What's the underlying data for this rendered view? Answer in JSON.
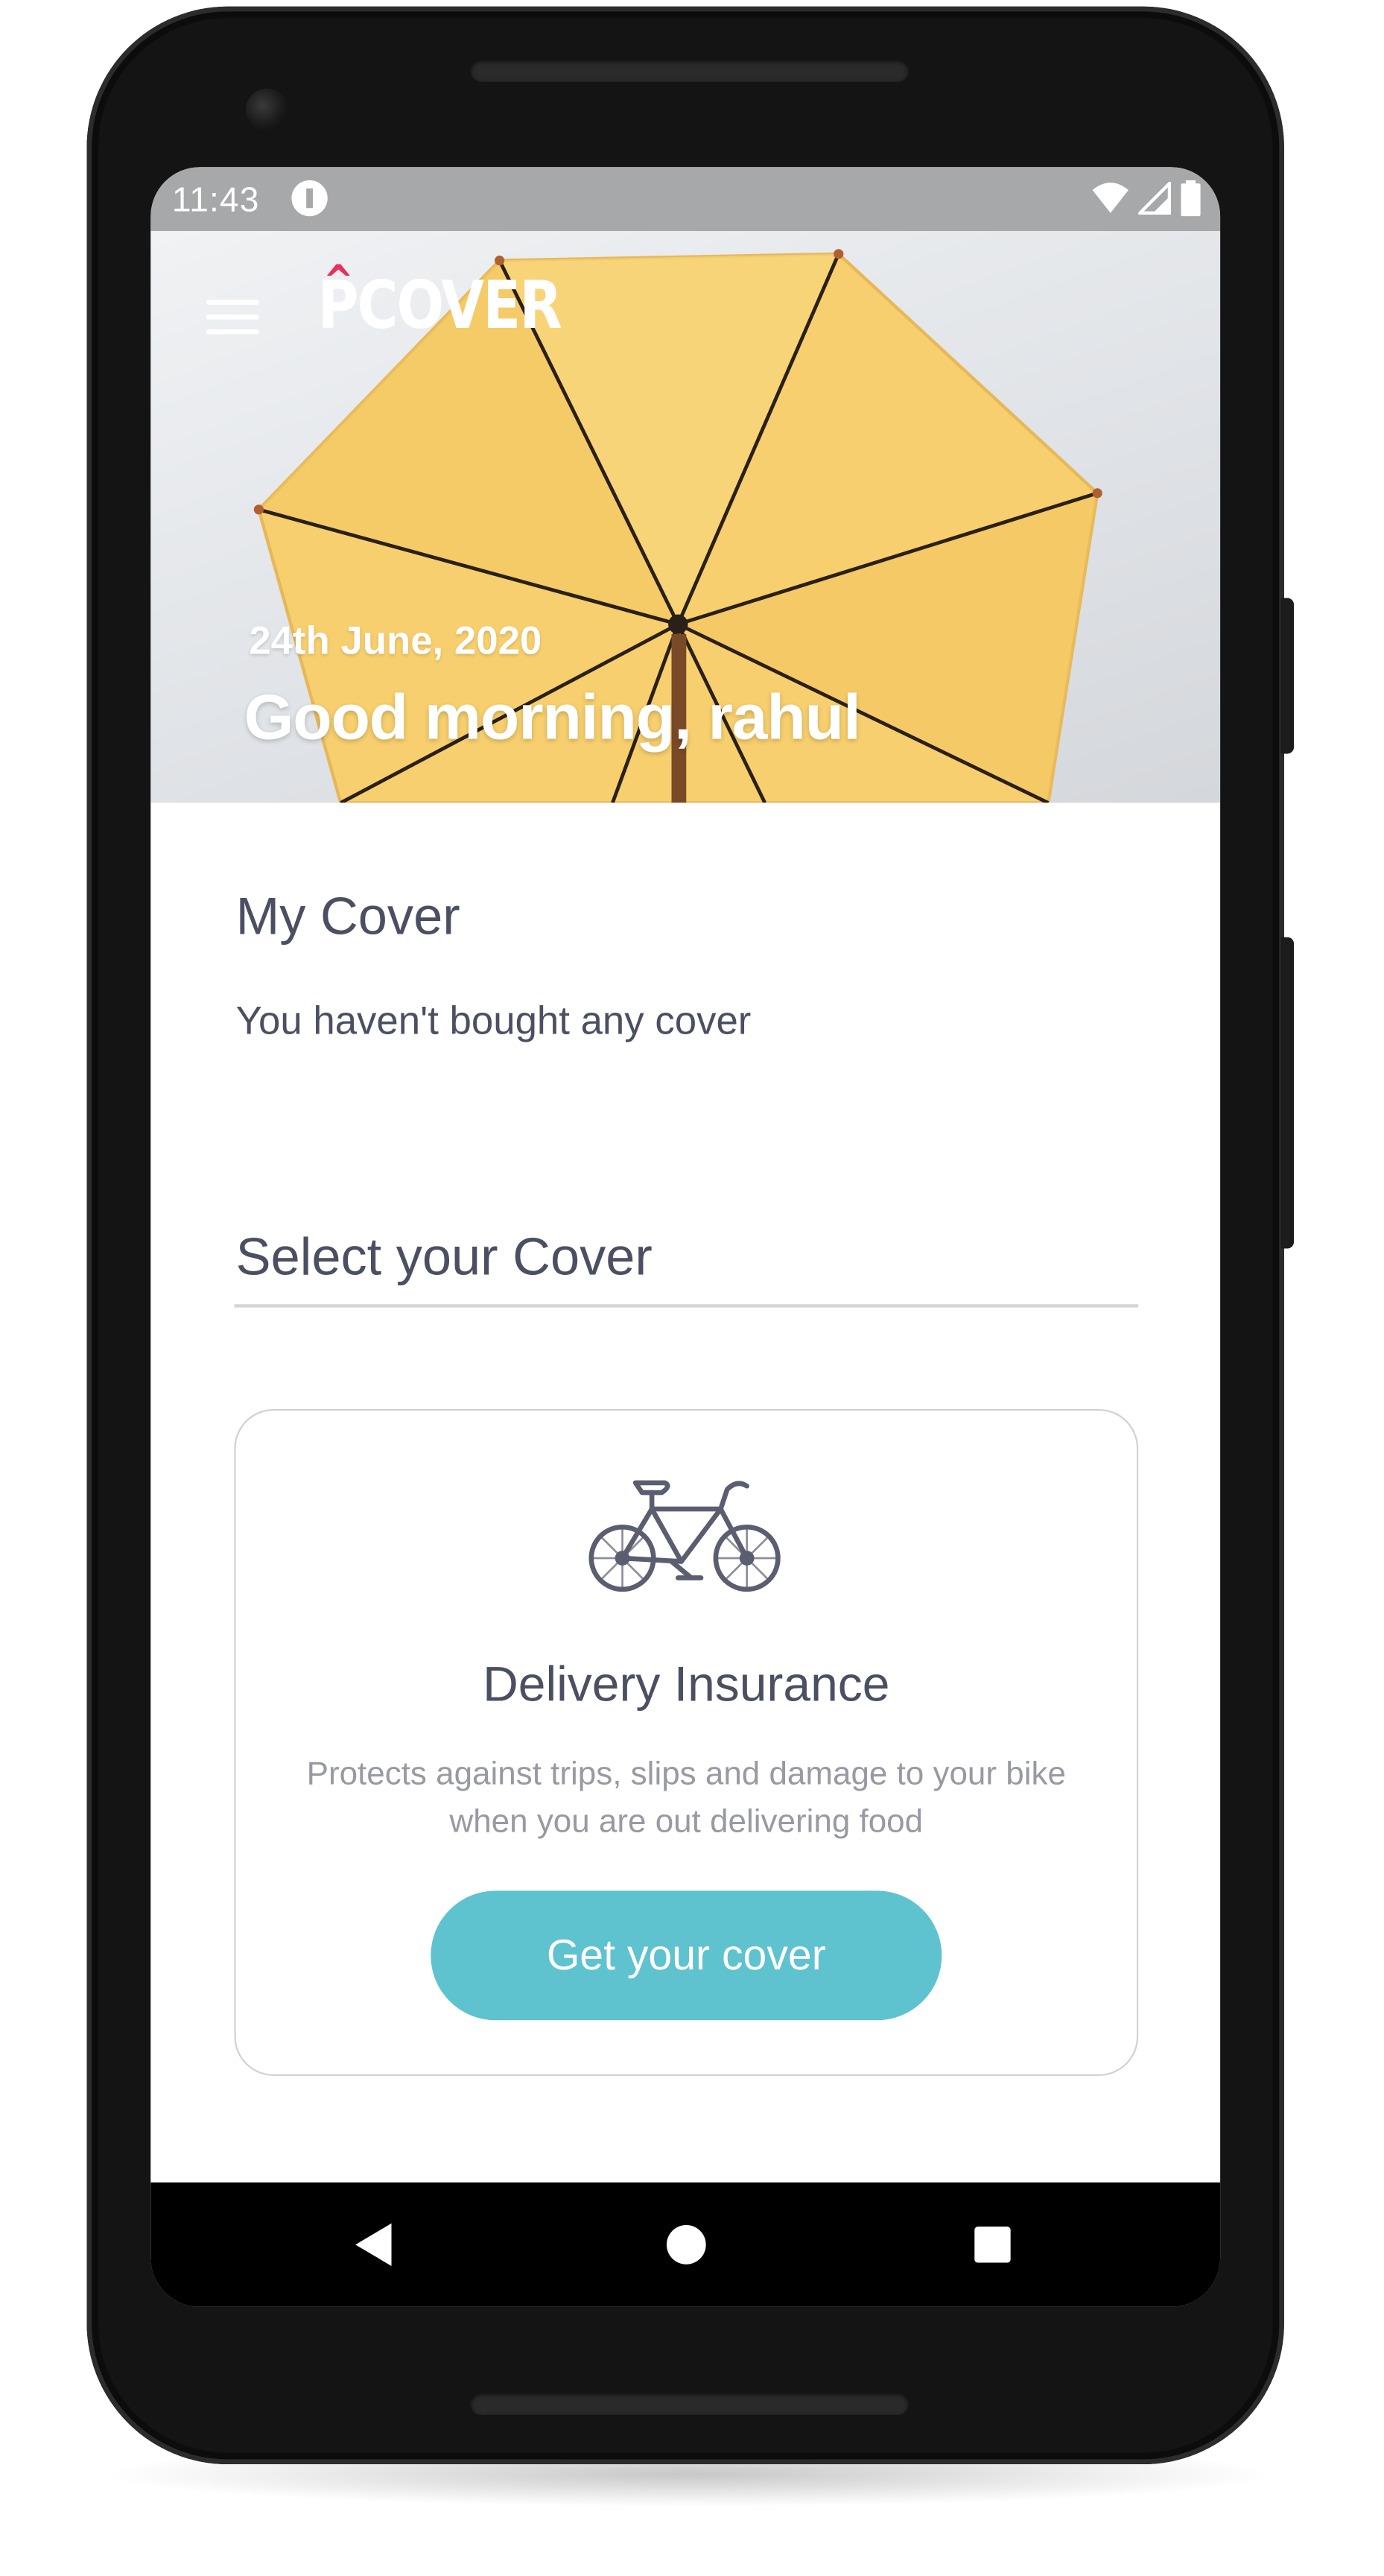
{
  "status_bar": {
    "time": "11:43",
    "icons": [
      "app-notification-icon",
      "wifi-icon",
      "signal-icon",
      "battery-icon"
    ]
  },
  "header": {
    "logo_text": "PCOVER",
    "logo_caret": "^",
    "menu_icon": "hamburger-menu-icon",
    "date": "24th June, 2020",
    "greeting": "Good morning, rahul"
  },
  "my_cover": {
    "title": "My Cover",
    "empty_text": "You haven't bought any cover"
  },
  "select_cover": {
    "title": "Select your Cover"
  },
  "cover_card": {
    "icon": "bicycle-icon",
    "title": "Delivery Insurance",
    "description": "Protects against trips, slips and damage to your bike when you are out delivering food",
    "button_label": "Get your cover"
  },
  "nav_bar": {
    "icons": [
      "back-icon",
      "home-icon",
      "recents-icon"
    ]
  },
  "colors": {
    "status_bar": "#a7a8aa",
    "text_primary": "#4b4f62",
    "text_secondary": "#989aa3",
    "accent_button": "#5ec2cf",
    "logo_caret": "#e8315a",
    "umbrella": "#f7cf6e"
  }
}
